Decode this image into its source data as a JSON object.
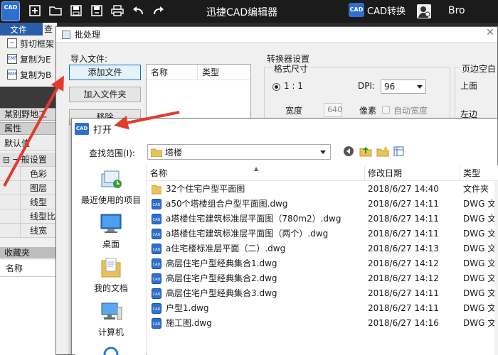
{
  "app": {
    "logo_text": "CAD",
    "title": "迅捷CAD编辑器",
    "cad_badge": "CAD",
    "cad_convert": "CAD转换",
    "user_name": "Bro"
  },
  "left_panel": {
    "menu_file": "文件",
    "menu_next": "查",
    "ribbon": [
      "剪切框架",
      "复制为E",
      "复制为B"
    ],
    "section_a": "某别野地工",
    "properties_header": "属性",
    "default_value": "默认值",
    "group_general": "一般设置",
    "props": [
      "色彩",
      "图层",
      "线型",
      "线型比",
      "线宽"
    ],
    "favorites": "收藏夹",
    "name_col": "名称"
  },
  "batch_dialog": {
    "title": "批处理",
    "import_label": "导入文件:",
    "add_file": "添加文件",
    "add_folder": "加入文件夹",
    "remove": "移除",
    "col_name": "名称",
    "col_type": "类型",
    "converter_settings": "转换器设置",
    "format_size": "格式尺寸",
    "ratio": "1 : 1",
    "dpi_label": "DPI:",
    "dpi_value": "96",
    "width_label": "宽度",
    "width_value": "640",
    "pixel_label": "像素",
    "auto_width": "自动宽度",
    "page_margin": "页边空白",
    "top_label": "上面",
    "left_label": "左边"
  },
  "open_dialog": {
    "badge": "CAD",
    "title": "打开",
    "look_in_label": "查找范围(I):",
    "look_in_value": "塔楼",
    "places": [
      "最近使用的项目",
      "桌面",
      "我的文档",
      "计算机"
    ],
    "columns": {
      "name": "名称",
      "date": "修改日期",
      "type": "类型"
    },
    "files": [
      {
        "name": "32个住宅户型平面图",
        "date": "2018/6/27 14:40",
        "type": "文件夹",
        "kind": "folder"
      },
      {
        "name": "a50个塔楼组合户型平面图.dwg",
        "date": "2018/6/27 14:11",
        "type": "DWG 文",
        "kind": "dwg"
      },
      {
        "name": "a塔楼住宅建筑标准层平面图（780m2）.dwg",
        "date": "2018/6/27 14:11",
        "type": "DWG 文",
        "kind": "dwg"
      },
      {
        "name": "a塔楼住宅建筑标准层平面图（两个）.dwg",
        "date": "2018/6/27 14:11",
        "type": "DWG 文",
        "kind": "dwg"
      },
      {
        "name": "a住宅楼标准层平面（二）.dwg",
        "date": "2018/6/27 14:13",
        "type": "DWG 文",
        "kind": "dwg"
      },
      {
        "name": "高层住宅户型经典集合1.dwg",
        "date": "2018/6/27 14:12",
        "type": "DWG 文",
        "kind": "dwg"
      },
      {
        "name": "高层住宅户型经典集合2.dwg",
        "date": "2018/6/27 14:12",
        "type": "DWG 文",
        "kind": "dwg"
      },
      {
        "name": "高层住宅户型经典集合3.dwg",
        "date": "2018/6/27 14:11",
        "type": "DWG 文",
        "kind": "dwg"
      },
      {
        "name": "户型1.dwg",
        "date": "2018/6/27 14:11",
        "type": "DWG 文",
        "kind": "dwg"
      },
      {
        "name": "施工图.dwg",
        "date": "2018/6/27 14:16",
        "type": "DWG 文",
        "kind": "dwg"
      }
    ]
  },
  "colors": {
    "accent": "#2f6fd0",
    "arrow": "#e23b2e",
    "titlebar": "#1b1b1b"
  }
}
